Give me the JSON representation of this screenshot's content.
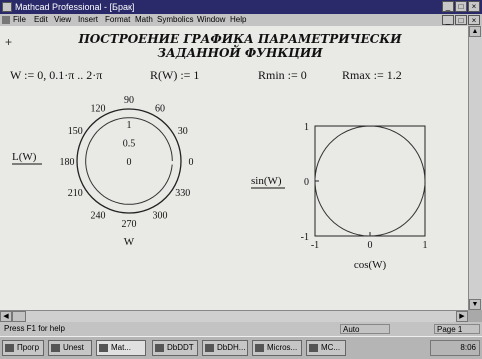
{
  "window": {
    "title": "Mathcad Professional - [Брак]",
    "buttons": [
      "_",
      "□",
      "×"
    ]
  },
  "menu": {
    "items": [
      "File",
      "Edit",
      "View",
      "Insert",
      "Format",
      "Math",
      "Symbolics",
      "Window",
      "Help"
    ],
    "doc_buttons": [
      "_",
      "□",
      "×"
    ]
  },
  "document": {
    "plus": "+",
    "heading_line1": "ПОСТРОЕНИЕ ГРАФИКА ПАРАМЕТРИЧЕСКИ",
    "heading_line2": "ЗАДАННОЙ ФУНКЦИИ",
    "defs": {
      "w_range": "W := 0, 0.1·π .. 2·π",
      "r_def": "R(W) := 1",
      "rmin": "Rmin := 0",
      "rmax": "Rmax := 1.2"
    }
  },
  "chart_data": [
    {
      "type": "polar",
      "series": [
        {
          "values_r": 1,
          "theta_range": [
            0,
            6.2832
          ]
        }
      ],
      "radial_ticks": [
        "1",
        "0.5",
        "0"
      ],
      "angle_ticks": [
        "0",
        "30",
        "60",
        "90",
        "120",
        "150",
        "180",
        "210",
        "240",
        "270",
        "300",
        "330"
      ],
      "ylabel": "L(W)",
      "xlabel": "W",
      "rlim": [
        0,
        1.2
      ]
    },
    {
      "type": "line",
      "x_expr": "cos(W)",
      "y_expr": "sin(W)",
      "xlabel": "cos(W)",
      "ylabel": "sin(W)",
      "xlim": [
        -1,
        1
      ],
      "ylim": [
        -1,
        1
      ],
      "x_ticks": [
        "-1",
        "0",
        "1"
      ],
      "y_ticks": [
        "1",
        "0",
        "-1"
      ]
    }
  ],
  "statusbar": {
    "help": "Press F1 for help",
    "mode": "Auto",
    "page": "Page 1"
  },
  "taskbar": {
    "items": [
      "Прогр",
      "Unest",
      "Mat...",
      "DbDDT",
      "DbDH...",
      "Micros...",
      "MC..."
    ],
    "clock": "8:06"
  }
}
